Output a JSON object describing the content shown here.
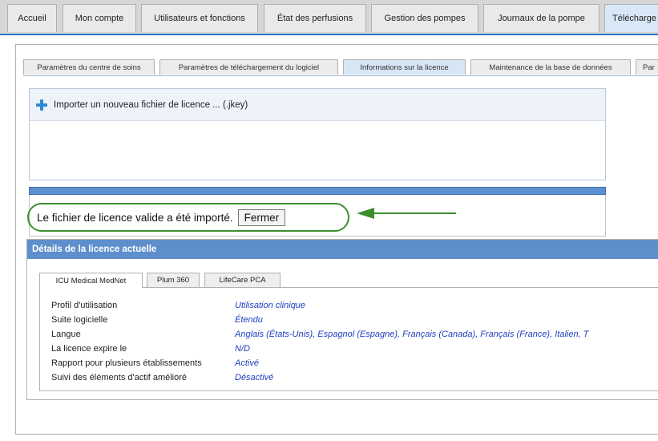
{
  "nav": {
    "tabs": [
      {
        "label": "Accueil"
      },
      {
        "label": "Mon compte"
      },
      {
        "label": "Utilisateurs et fonctions"
      },
      {
        "label": "État des perfusions"
      },
      {
        "label": "Gestion des pompes"
      },
      {
        "label": "Journaux de la pompe"
      },
      {
        "label": "Télécharge"
      }
    ]
  },
  "subtabs": [
    {
      "label": "Paramètres du centre de soins"
    },
    {
      "label": "Paramètres de téléchargement du logiciel"
    },
    {
      "label": "Informations sur la licence"
    },
    {
      "label": "Maintenance de la base de données"
    },
    {
      "label": "Par"
    }
  ],
  "import": {
    "label": "Importer un nouveau fichier de licence ... (.jkey)"
  },
  "message": {
    "text": "Le fichier de licence valide a été importé.",
    "close_label": "Fermer"
  },
  "details": {
    "title": "Détails de la licence actuelle",
    "product_tabs": [
      {
        "label": "ICU Medical MedNet"
      },
      {
        "label": "Plum 360"
      },
      {
        "label": "LifeCare PCA"
      }
    ],
    "rows": [
      {
        "label": "Profil d'utilisation",
        "value": "Utilisation clinique"
      },
      {
        "label": "Suite logicielle",
        "value": "Étendu"
      },
      {
        "label": "Langue",
        "value": "Anglais (États-Unis), Espagnol (Espagne), Français (Canada), Français (France), Italien, T"
      },
      {
        "label": "La licence expire le",
        "value": "N/D"
      },
      {
        "label": "Rapport pour plusieurs établissements",
        "value": "Activé"
      },
      {
        "label": "Suivi des éléments d'actif amélioré",
        "value": "Désactivé"
      }
    ]
  },
  "colors": {
    "accent": "#2e75c5",
    "header_bar": "#5e8fcc",
    "highlight_ring": "#3d8f2e",
    "arrow": "#3d8f2e",
    "value_text": "#1f3fbf"
  }
}
